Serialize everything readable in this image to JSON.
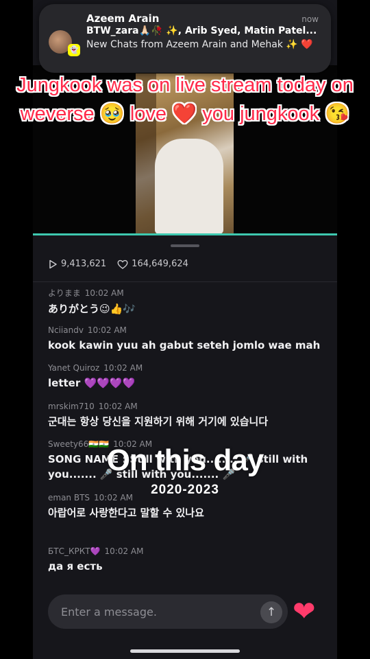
{
  "notification": {
    "title": "Azeem Arain",
    "time": "now",
    "line2": "BTW_zara🙏🏻🥀 ✨, Arib Syed, Matin Patel...",
    "line3": "New Chats from Azeem Arain and Mehak ✨ ❤️"
  },
  "overlay_caption": "Jungkook was on live stream today on weverse 🥹 love ❤️ you jungkook 😘",
  "stats": {
    "plays": "9,413,621",
    "likes": "164,649,624"
  },
  "comments": [
    {
      "user": "よりまま",
      "time": "10:02 AM",
      "text": "ありがとう😉👍🎶"
    },
    {
      "user": "Nciiandv",
      "time": "10:02 AM",
      "text": "kook kawin yuu ah gabut seteh jomlo wae mah"
    },
    {
      "user": "Yanet Quiroz",
      "time": "10:02 AM",
      "text": "letter 💜💜💜💜"
    },
    {
      "user": "mrskim710",
      "time": "10:02 AM",
      "text": "군대는 항상 당신을 지원하기 위해 거기에 있습니다"
    },
    {
      "user": "Sweety66🇮🇳🇮🇳",
      "time": "10:02 AM",
      "text": "SONG NAME : Still with you........ 🎤 still with you....... 🎤 still with you....... 🎤"
    },
    {
      "user": "eman BTS",
      "time": "10:02 AM",
      "text": "아랍어로 사랑한다고 말할 수 있나요"
    },
    {
      "user": "БТС_КРКТ💜",
      "time": "10:02 AM",
      "text": "да я есть"
    }
  ],
  "overlay_title": "On this day",
  "overlay_years": "2020-2023",
  "input": {
    "placeholder": "Enter a message."
  },
  "icons": {
    "play": "play-icon",
    "heart": "heart-outline-icon",
    "send": "arrow-up-icon",
    "like": "heart-filled-icon"
  },
  "colors": {
    "accent": "#3ec9b0",
    "heart": "#ff3b6b",
    "caption": "#ff2a4a"
  }
}
